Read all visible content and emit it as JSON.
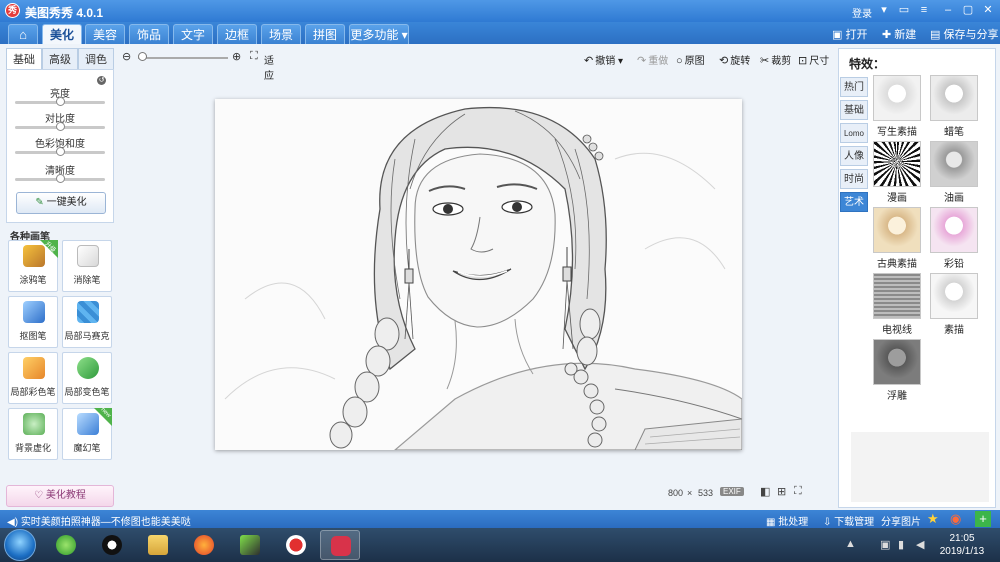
{
  "window": {
    "title": "美图秀秀 4.0.1",
    "logo_text": "秀",
    "login": "登录"
  },
  "tabs": [
    {
      "label": "⌂"
    },
    {
      "label": "美化"
    },
    {
      "label": "美容"
    },
    {
      "label": "饰品"
    },
    {
      "label": "文字"
    },
    {
      "label": "边框"
    },
    {
      "label": "场景"
    },
    {
      "label": "拼图"
    },
    {
      "label": "更多功能 ▾"
    }
  ],
  "header_actions": {
    "open": "打开",
    "new": "新建",
    "save": "保存与分享"
  },
  "left": {
    "subtabs": [
      "基础",
      "高级",
      "调色"
    ],
    "adjust": [
      {
        "label": "亮度",
        "value": 0.5
      },
      {
        "label": "对比度",
        "value": 0.5
      },
      {
        "label": "色彩饱和度",
        "value": 0.5
      },
      {
        "label": "清晰度",
        "value": 0.5
      }
    ],
    "one_key": "一键美化",
    "brush_title": "各种画笔",
    "brushes": [
      {
        "label": "涂鸦笔",
        "badge": "升级"
      },
      {
        "label": "消除笔",
        "badge": ""
      },
      {
        "label": "抠图笔",
        "badge": ""
      },
      {
        "label": "局部马赛克",
        "badge": ""
      },
      {
        "label": "局部彩色笔",
        "badge": ""
      },
      {
        "label": "局部变色笔",
        "badge": ""
      },
      {
        "label": "背景虚化",
        "badge": ""
      },
      {
        "label": "魔幻笔",
        "badge": "new"
      }
    ],
    "tutorial": "美化教程"
  },
  "toolbar": {
    "fit": "适应",
    "undo": "撤销",
    "redo": "重做",
    "original": "原图",
    "rotate": "旋转",
    "crop": "裁剪",
    "resize": "尺寸"
  },
  "image_info": {
    "width": "800",
    "sep": "×",
    "height": "533",
    "exif": "EXIF"
  },
  "right": {
    "heading": "特效：",
    "vtabs": [
      "热门",
      "基础",
      "Lomo",
      "人像",
      "时尚",
      "艺术"
    ],
    "active_vtab": "艺术",
    "effects": [
      {
        "label": "写生素描"
      },
      {
        "label": "蜡笔"
      },
      {
        "label": "漫画"
      },
      {
        "label": "油画"
      },
      {
        "label": "古典素描"
      },
      {
        "label": "彩铅"
      },
      {
        "label": "电视线"
      },
      {
        "label": "素描"
      },
      {
        "label": "浮雕"
      }
    ]
  },
  "status": {
    "tip": "实时美颜拍照神器—不修图也能美美哒",
    "batch": "批处理",
    "downloads": "下载管理",
    "share": "分享图片"
  },
  "taskbar": {
    "time": "21:05",
    "date": "2019/1/13"
  }
}
